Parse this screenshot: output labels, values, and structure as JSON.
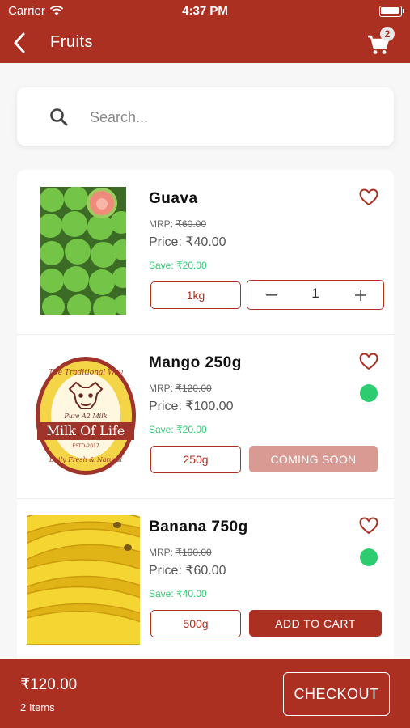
{
  "status_bar": {
    "carrier": "Carrier",
    "time": "4:37 PM"
  },
  "app_bar": {
    "title": "Fruits",
    "cart_count": "2"
  },
  "search": {
    "placeholder": "Search..."
  },
  "products": [
    {
      "name": "Guava",
      "mrp_label": "MRP: ",
      "mrp_value": "₹60.00",
      "price": "Price: ₹40.00",
      "save": "Save: ₹20.00",
      "weight": "1kg",
      "quantity": "1",
      "image": "guava-image"
    },
    {
      "name": "Mango 250g",
      "mrp_label": "MRP: ",
      "mrp_value": "₹120.00",
      "price": "Price: ₹100.00",
      "save": "Save: ₹20.00",
      "weight": "250g",
      "action": "COMING SOON",
      "logo_text": "The Traditional Way",
      "logo_sub": "Pure A2 Milk",
      "logo_brand": "Milk Of Life",
      "logo_estd": "ESTD-2017",
      "logo_tagline": "Daily Fresh & Natural",
      "image": "milk-of-life-logo"
    },
    {
      "name": "Banana 750g",
      "mrp_label": "MRP: ",
      "mrp_value": "₹100.00",
      "price": "Price: ₹60.00",
      "save": "Save: ₹40.00",
      "weight": "500g",
      "action": "ADD TO CART",
      "image": "banana-image"
    }
  ],
  "footer": {
    "total": "₹120.00",
    "items": "2 Items",
    "checkout": "CHECKOUT"
  },
  "colors": {
    "primary": "#ac3022",
    "green": "#2ecc71",
    "coming_soon": "#d89a92"
  }
}
